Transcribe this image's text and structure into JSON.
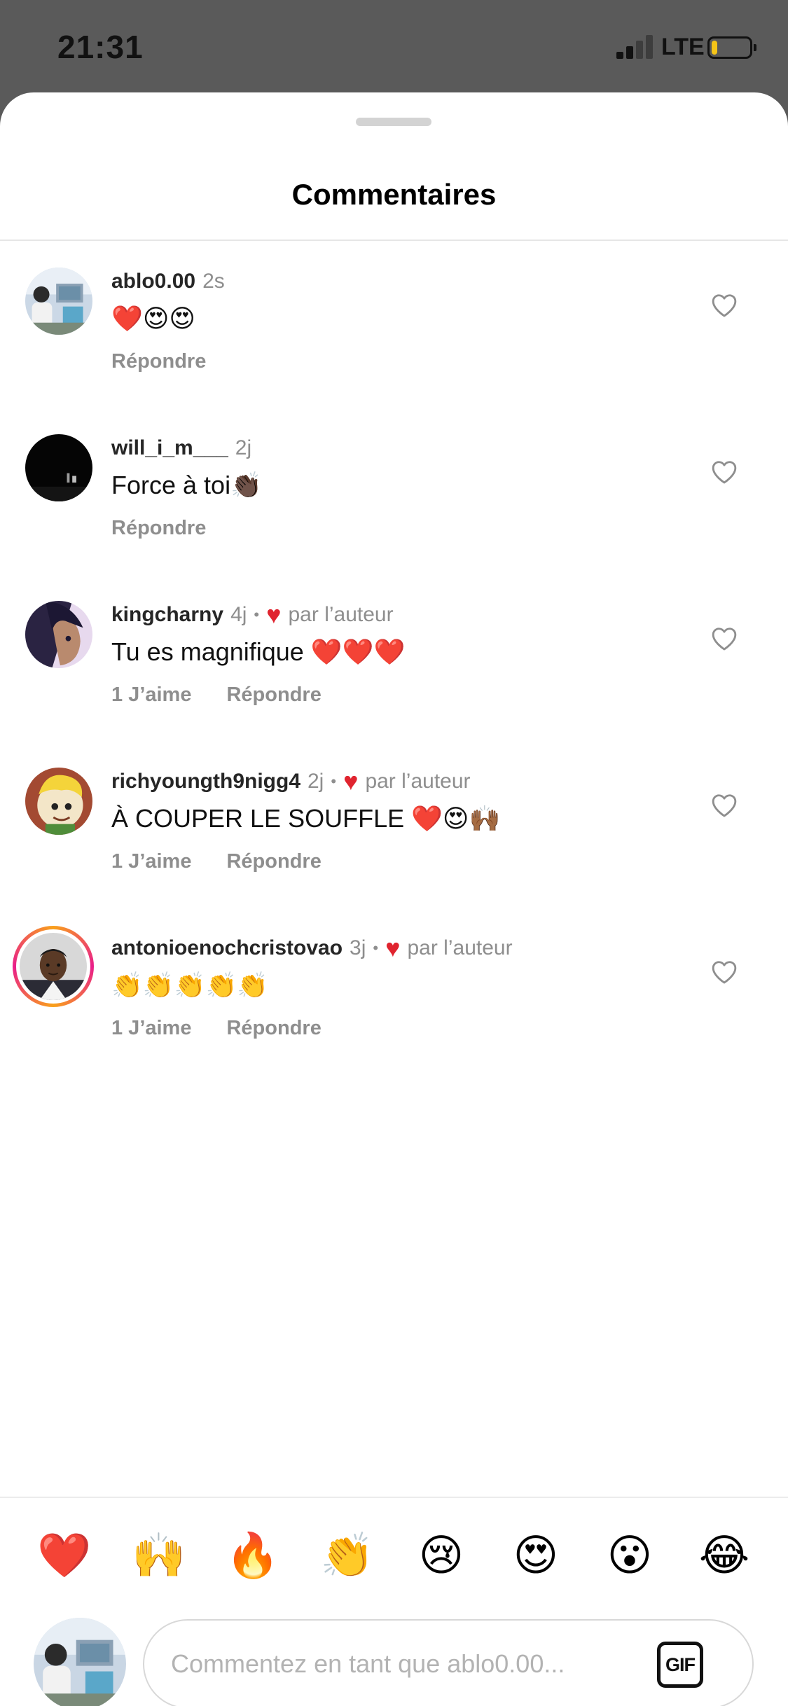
{
  "status_bar": {
    "time": "21:31",
    "network": "LTE",
    "signal_bars_active": 2,
    "signal_bars_total": 4,
    "battery_level": 0.15,
    "battery_color": "#f5c518"
  },
  "sheet": {
    "title": "Commentaires"
  },
  "comments": [
    {
      "username": "ablo0.00",
      "time": "2s",
      "text": "❤️😍😍",
      "liked_by_author": false,
      "author_label": "",
      "likes": "",
      "reply_label": "Répondre",
      "avatar": "photo-outdoor",
      "story_ring": false
    },
    {
      "username": "will_i_m___",
      "time": "2j",
      "text": "Force à toi👏🏿",
      "liked_by_author": false,
      "author_label": "",
      "likes": "",
      "reply_label": "Répondre",
      "avatar": "photo-dark",
      "story_ring": false
    },
    {
      "username": "kingcharny",
      "time": "4j",
      "text": "Tu es magnifique ❤️❤️❤️",
      "liked_by_author": true,
      "author_label": "par l’auteur",
      "likes": "1 J’aime",
      "reply_label": "Répondre",
      "avatar": "illustration-face",
      "story_ring": false
    },
    {
      "username": "richyoungth9nigg4",
      "time": "2j",
      "text": "À COUPER LE SOUFFLE ❤️😍🙌🏾",
      "liked_by_author": true,
      "author_label": "par l’auteur",
      "likes": "1 J’aime",
      "reply_label": "Répondre",
      "avatar": "cartoon-character",
      "story_ring": false
    },
    {
      "username": "antonioenochcristovao",
      "time": "3j",
      "text": "👏👏👏👏👏",
      "liked_by_author": true,
      "author_label": "par l’auteur",
      "likes": "1 J’aime",
      "reply_label": "Répondre",
      "avatar": "portrait-man",
      "story_ring": true
    }
  ],
  "quick_reactions": [
    "❤️",
    "🙌",
    "🔥",
    "👏",
    "😢",
    "😍",
    "😮",
    "😂"
  ],
  "composer": {
    "placeholder": "Commentez en tant que ablo0.00...",
    "value": "",
    "gif_label": "GIF"
  },
  "colors": {
    "author_heart": "#e0242f",
    "secondary_text": "#8e8e8e",
    "story_ring_start": "#f9a11b",
    "story_ring_end": "#e91e8a"
  },
  "icons": {
    "like": "heart-outline-icon",
    "author_like": "heart-filled-icon",
    "gif": "gif-icon"
  }
}
